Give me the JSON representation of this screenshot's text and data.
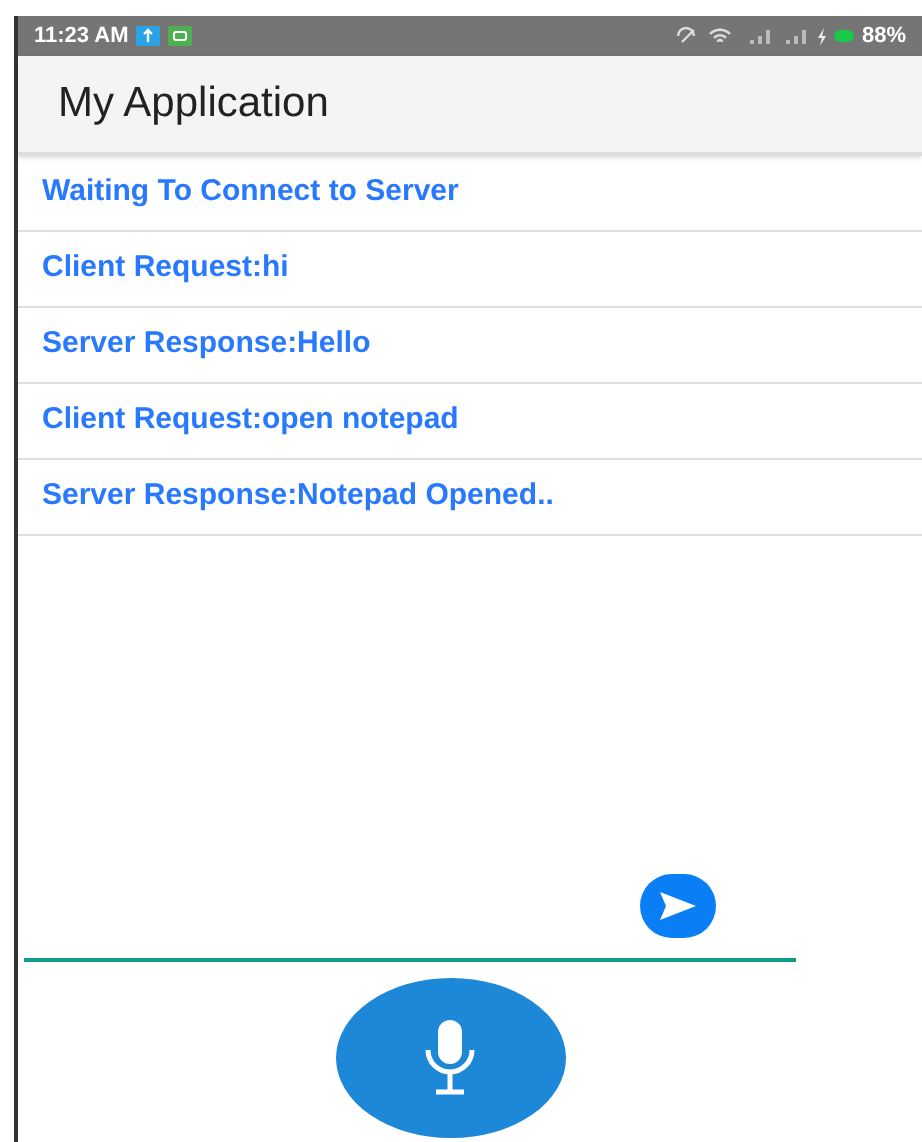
{
  "status_bar": {
    "time": "11:23 AM",
    "battery": "88%"
  },
  "app_bar": {
    "title": "My Application"
  },
  "messages": [
    "Waiting To Connect to Server",
    "Client Request:hi",
    "Server Response:Hello",
    "Client Request:open notepad",
    "Server Response:Notepad Opened.."
  ]
}
